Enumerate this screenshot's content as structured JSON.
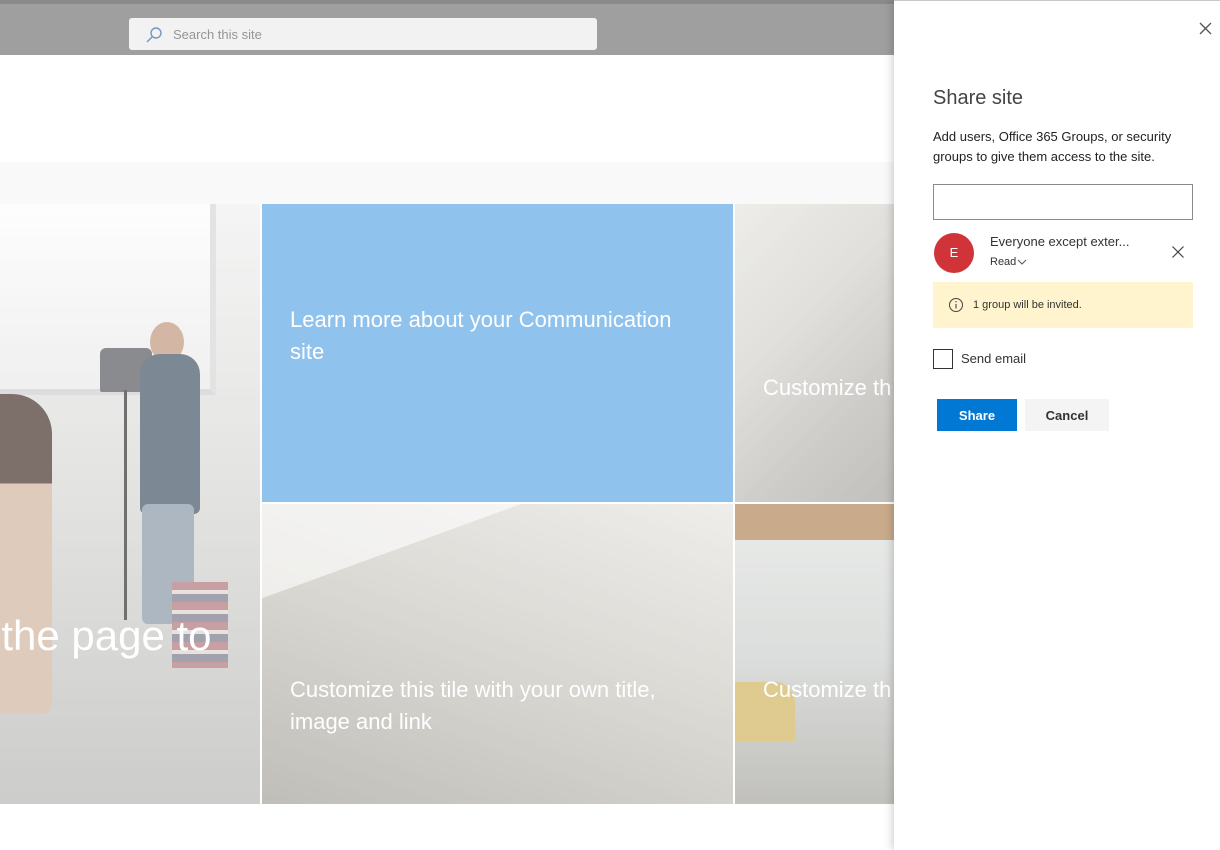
{
  "search": {
    "placeholder": "Search this site"
  },
  "tiles": {
    "main_overlay_text": "f the page to",
    "blue_tile_text": "Learn more about your Communication site",
    "tile_top_right_text": "Customize th\nimage and lir",
    "tile_bottom_middle_text": "Customize this tile with your own title,\nimage and link",
    "tile_bottom_right_text": "Customize th\nimage and lir"
  },
  "share_panel": {
    "title": "Share site",
    "description": "Add users, Office 365 Groups, or security groups to give them access to the site.",
    "input_value": "",
    "persona": {
      "initial": "E",
      "name": "Everyone except exter...",
      "permission": "Read",
      "avatar_color": "#d13438"
    },
    "info_message": "1 group will be invited.",
    "send_email_label": "Send email",
    "send_email_checked": false,
    "share_label": "Share",
    "cancel_label": "Cancel"
  },
  "icons": {
    "search": "search-icon",
    "close": "close-icon",
    "remove": "remove-icon",
    "chevron": "chevron-down-icon",
    "info": "info-icon"
  },
  "colors": {
    "primary": "#0078d4",
    "tile_blue": "#65abe5",
    "info_bar": "#fff4ce",
    "suite_bar": "#7a7b7c"
  }
}
